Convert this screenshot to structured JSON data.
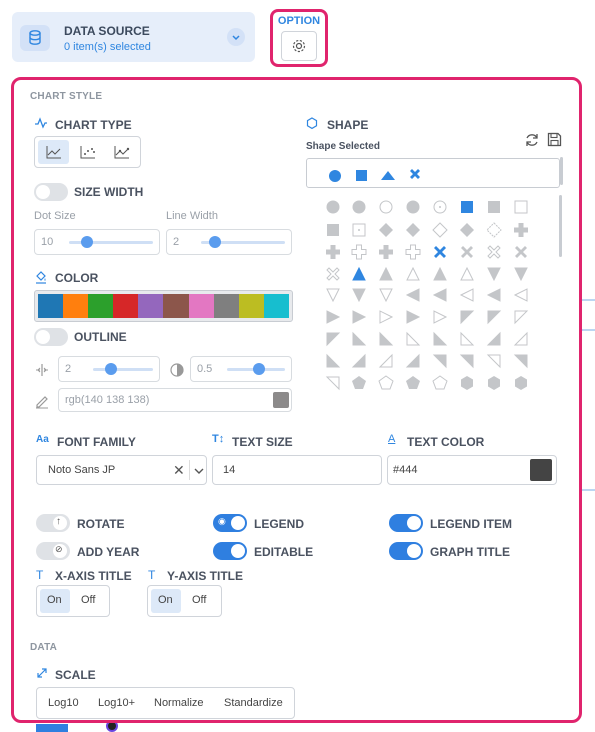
{
  "data_source": {
    "title": "DATA SOURCE",
    "subtitle": "0 item(s) selected"
  },
  "option": {
    "label": "OPTION"
  },
  "chart_style": {
    "section_title": "CHART STYLE",
    "chart_type_label": "CHART TYPE",
    "size_width_label": "SIZE WIDTH",
    "dot_size_label": "Dot Size",
    "dot_size_value": "10",
    "line_width_label": "Line Width",
    "line_width_value": "2",
    "color_label": "COLOR",
    "palette": [
      "#1f77b4",
      "#ff7f0e",
      "#2ca02c",
      "#d62728",
      "#9467bd",
      "#8c564b",
      "#e377c2",
      "#7f7f7f",
      "#bcbd22",
      "#17becf"
    ],
    "outline_label": "OUTLINE",
    "outline_width_value": "2",
    "outline_opacity_value": "0.5",
    "outline_color_value": "rgb(140 138 138)",
    "shape_label": "SHAPE",
    "shape_selected_label": "Shape Selected"
  },
  "text_style": {
    "font_family_label": "FONT FAMILY",
    "font_family_value": "Noto Sans JP",
    "text_size_label": "TEXT SIZE",
    "text_size_value": "14",
    "text_color_label": "TEXT COLOR",
    "text_color_value": "#444"
  },
  "toggles": {
    "rotate": "ROTATE",
    "add_year": "ADD YEAR",
    "legend": "LEGEND",
    "editable": "EDITABLE",
    "legend_item": "LEGEND ITEM",
    "graph_title": "GRAPH TITLE"
  },
  "axis": {
    "x_title": "X-AXIS TITLE",
    "y_title": "Y-AXIS TITLE",
    "on": "On",
    "off": "Off"
  },
  "data_section": {
    "section_title": "DATA",
    "scale_label": "SCALE",
    "scale_options": [
      "Log10",
      "Log10+",
      "Normalize",
      "Standardize"
    ]
  }
}
